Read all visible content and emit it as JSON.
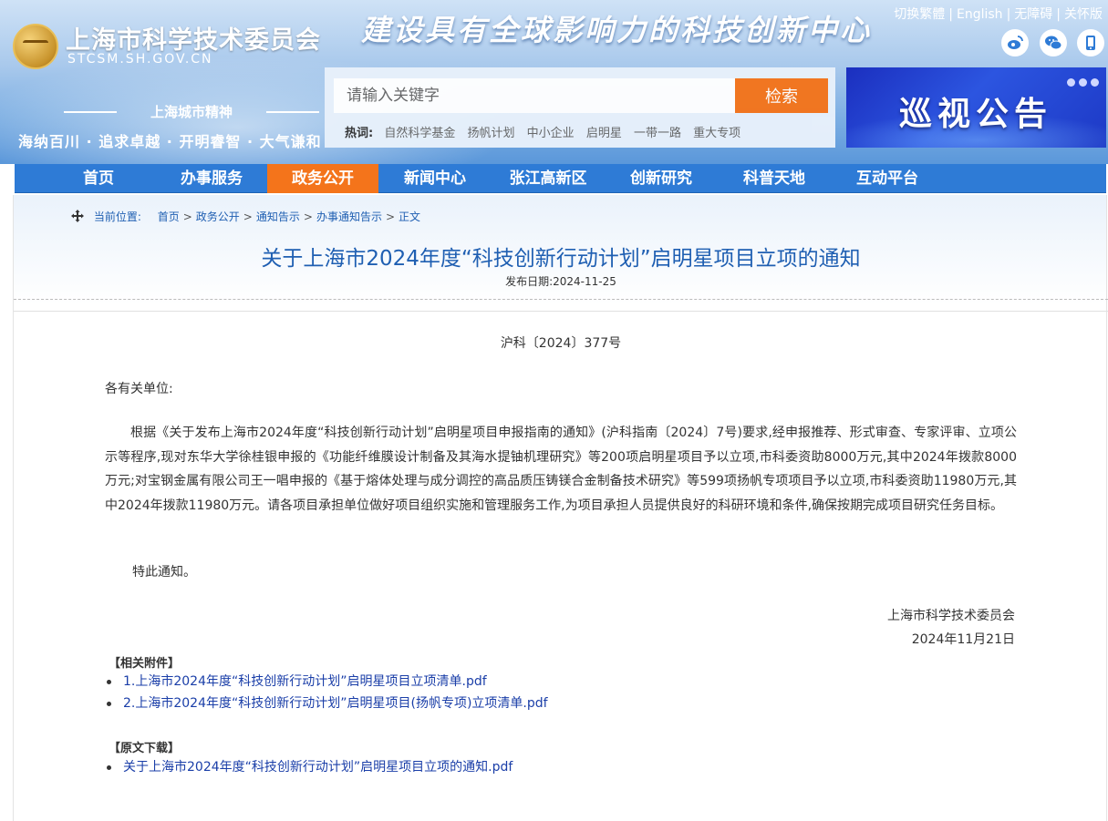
{
  "header": {
    "site_name": "上海市科学技术委员会",
    "site_domain": "STCSM.SH.GOV.CN",
    "slogan": "建设具有全球影响力的科技创新中心",
    "spirit_title": "上海城市精神",
    "spirit_text": "海纳百川 · 追求卓越 · 开明睿智 · 大气谦和",
    "top_links": [
      "切换繁體",
      "English",
      "无障碍",
      "关怀版"
    ],
    "social_icons": [
      "weibo-icon",
      "wechat-icon",
      "mobile-icon"
    ]
  },
  "search": {
    "placeholder": "请输入关键字",
    "button_label": "检索",
    "hot_label": "热词:",
    "hot_words": [
      "自然科学基金",
      "扬帆计划",
      "中小企业",
      "启明星",
      "一带一路",
      "重大专项"
    ]
  },
  "banner": {
    "text": "巡视公告"
  },
  "nav": {
    "items": [
      "首页",
      "办事服务",
      "政务公开",
      "新闻中心",
      "张江高新区",
      "创新研究",
      "科普天地",
      "互动平台"
    ],
    "active": "政务公开"
  },
  "breadcrumb": {
    "label": "当前位置:",
    "items": [
      "首页",
      "政务公开",
      "通知告示",
      "办事通知告示",
      "正文"
    ]
  },
  "article": {
    "title": "关于上海市2024年度“科技创新行动计划”启明星项目立项的通知",
    "publish_date": "发布日期:2024-11-25",
    "doc_number": "沪科〔2024〕377号",
    "addressee": "各有关单位:",
    "body": "根据《关于发布上海市2024年度“科技创新行动计划”启明星项目申报指南的通知》(沪科指南〔2024〕7号)要求,经申报推荐、形式审查、专家评审、立项公示等程序,现对东华大学徐桂银申报的《功能纤维膜设计制备及其海水提铀机理研究》等200项启明星项目予以立项,市科委资助8000万元,其中2024年拨款8000万元;对宝钢金属有限公司王一唱申报的《基于熔体处理与成分调控的高品质压铸镁合金制备技术研究》等599项扬帆专项项目予以立项,市科委资助11980万元,其中2024年拨款11980万元。请各项目承担单位做好项目组织实施和管理服务工作,为项目承担人员提供良好的科研环境和条件,确保按期完成项目研究任务目标。",
    "closing": "特此通知。",
    "signature_org": "上海市科学技术委员会",
    "signature_date": "2024年11月21日"
  },
  "attachments": {
    "heading": "【相关附件】",
    "items": [
      "1.上海市2024年度“科技创新行动计划”启明星项目立项清单.pdf",
      "2.上海市2024年度“科技创新行动计划”启明星项目(扬帆专项)立项清单.pdf"
    ]
  },
  "original": {
    "heading": "【原文下载】",
    "items": [
      "关于上海市2024年度“科技创新行动计划”启明星项目立项的通知.pdf"
    ]
  },
  "colors": {
    "nav_bg": "#2e7bd6",
    "accent_orange": "#f4741b",
    "title_blue": "#1f5fb2",
    "link_blue": "#1a3ea8"
  }
}
